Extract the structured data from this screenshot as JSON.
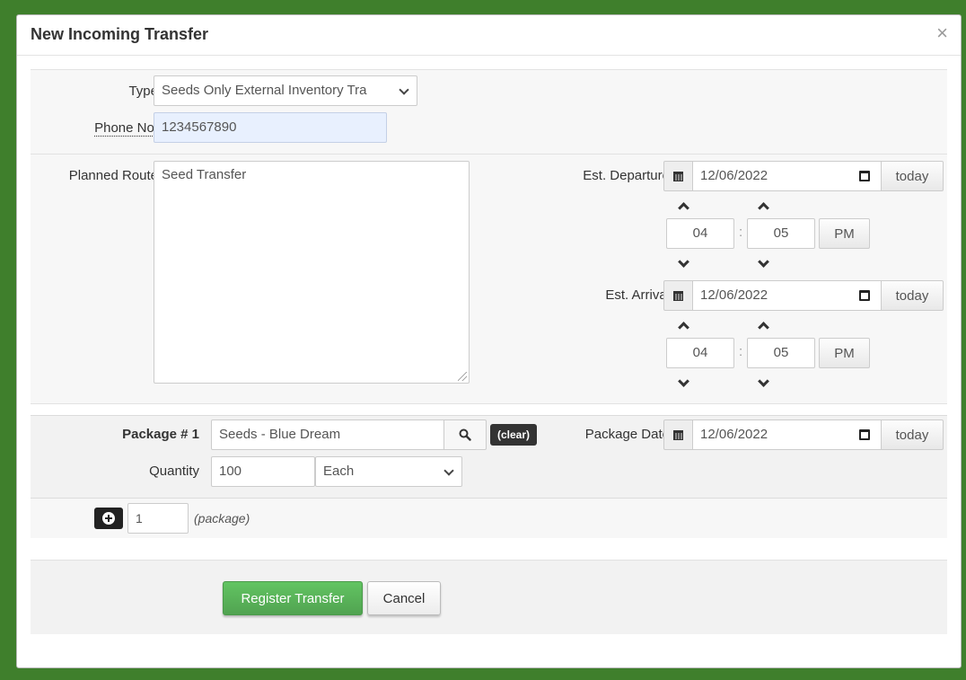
{
  "modal": {
    "title": "New Incoming Transfer",
    "close_label": "×"
  },
  "form": {
    "type_label": "Type",
    "type_value": "Seeds Only External Inventory Tra",
    "phone_label": "Phone No.",
    "phone_value": "1234567890",
    "planned_route_label": "Planned Route",
    "planned_route_value": "Seed Transfer"
  },
  "departure": {
    "label": "Est. Departure",
    "date": "12/06/2022",
    "today_label": "today",
    "hour": "04",
    "minute": "05",
    "meridiem": "PM"
  },
  "arrival": {
    "label": "Est. Arrival",
    "date": "12/06/2022",
    "today_label": "today",
    "hour": "04",
    "minute": "05",
    "meridiem": "PM"
  },
  "package": {
    "label": "Package # 1",
    "item_value": "Seeds - Blue Dream",
    "clear_label": "(clear)",
    "date_label": "Package Date",
    "date": "12/06/2022",
    "today_label": "today",
    "quantity_label": "Quantity",
    "quantity_value": "100",
    "unit_value": "Each"
  },
  "add_packages": {
    "count": "1",
    "note": "(package)"
  },
  "footer": {
    "register_label": "Register Transfer",
    "cancel_label": "Cancel"
  }
}
